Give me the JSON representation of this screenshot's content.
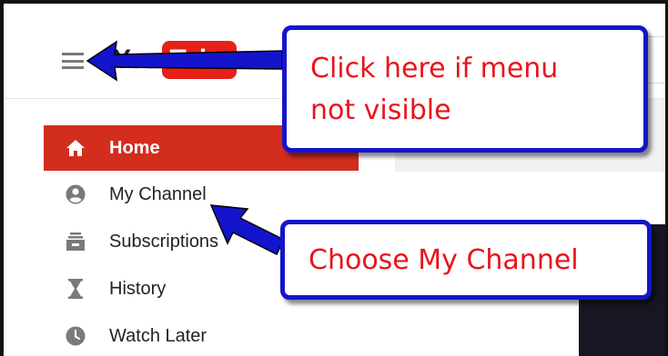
{
  "header": {
    "logo_you": "You",
    "logo_tube": "Tube"
  },
  "sidebar": {
    "items": [
      {
        "label": "Home",
        "icon": "home-icon",
        "active": true
      },
      {
        "label": "My Channel",
        "icon": "account-circle-icon",
        "active": false
      },
      {
        "label": "Subscriptions",
        "icon": "subscriptions-icon",
        "active": false
      },
      {
        "label": "History",
        "icon": "hourglass-icon",
        "active": false
      },
      {
        "label": "Watch Later",
        "icon": "clock-icon",
        "active": false
      }
    ]
  },
  "annotations": {
    "menu_callout_line1": "Click here if menu",
    "menu_callout_line2": "not visible",
    "channel_callout": "Choose My Channel"
  },
  "colors": {
    "active_nav": "#d22d1d",
    "logo_red": "#e62117",
    "callout_border": "#1414cc",
    "callout_text": "#e8141c"
  }
}
